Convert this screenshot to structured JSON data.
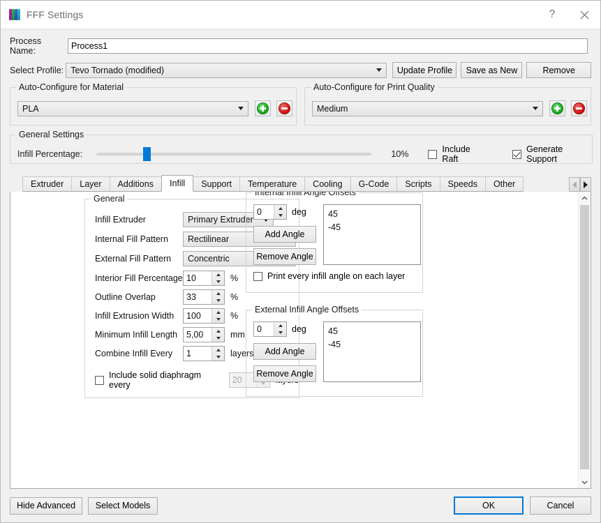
{
  "window": {
    "title": "FFF Settings",
    "icon": "cube-logo-icon",
    "help_label": "?",
    "close_label": "✕"
  },
  "header": {
    "process_name_label": "Process Name:",
    "process_name_value": "Process1",
    "select_profile_label": "Select Profile:",
    "select_profile_value": "Tevo Tornado (modified)",
    "update_profile_label": "Update Profile",
    "save_as_new_label": "Save as New",
    "remove_label": "Remove"
  },
  "material": {
    "group_title": "Auto-Configure for Material",
    "value": "PLA",
    "add_label": "+",
    "remove_label": "−"
  },
  "quality": {
    "group_title": "Auto-Configure for Print Quality",
    "value": "Medium",
    "add_label": "+",
    "remove_label": "−"
  },
  "general_settings": {
    "group_title": "General Settings",
    "infill_label": "Infill Percentage:",
    "infill_value": "10%",
    "infill_percent": 10,
    "include_raft_label": "Include Raft",
    "include_raft_checked": false,
    "generate_support_label": "Generate Support",
    "generate_support_checked": true
  },
  "tabs": {
    "items": [
      {
        "label": "Extruder",
        "active": false
      },
      {
        "label": "Layer",
        "active": false
      },
      {
        "label": "Additions",
        "active": false
      },
      {
        "label": "Infill",
        "active": true
      },
      {
        "label": "Support",
        "active": false
      },
      {
        "label": "Temperature",
        "active": false
      },
      {
        "label": "Cooling",
        "active": false
      },
      {
        "label": "G-Code",
        "active": false
      },
      {
        "label": "Scripts",
        "active": false
      },
      {
        "label": "Speeds",
        "active": false
      },
      {
        "label": "Other",
        "active": false
      }
    ],
    "prev_arrow": "◀",
    "next_arrow": "▶"
  },
  "infill": {
    "general": {
      "group_title": "General",
      "infill_extruder_label": "Infill Extruder",
      "infill_extruder_value": "Primary Extruder",
      "internal_fill_pattern_label": "Internal Fill Pattern",
      "internal_fill_pattern_value": "Rectilinear",
      "external_fill_pattern_label": "External Fill Pattern",
      "external_fill_pattern_value": "Concentric",
      "interior_fill_percentage_label": "Interior Fill Percentage",
      "interior_fill_percentage_value": "10",
      "interior_fill_percentage_unit": "%",
      "outline_overlap_label": "Outline Overlap",
      "outline_overlap_value": "33",
      "outline_overlap_unit": "%",
      "infill_extrusion_width_label": "Infill Extrusion Width",
      "infill_extrusion_width_value": "100",
      "infill_extrusion_width_unit": "%",
      "minimum_infill_length_label": "Minimum Infill Length",
      "minimum_infill_length_value": "5,00",
      "minimum_infill_length_unit": "mm",
      "combine_infill_every_label": "Combine Infill Every",
      "combine_infill_every_value": "1",
      "combine_infill_every_unit": "layers",
      "diaphragm_label": "Include solid diaphragm every",
      "diaphragm_checked": false,
      "diaphragm_value": "20",
      "diaphragm_unit": "layers"
    },
    "internal_offsets": {
      "group_title": "Internal Infill Angle Offsets",
      "angle_value": "0",
      "deg_label": "deg",
      "add_label": "Add Angle",
      "remove_label": "Remove Angle",
      "angles": [
        "45",
        "-45"
      ],
      "print_every_label": "Print every infill angle on each layer",
      "print_every_checked": false
    },
    "external_offsets": {
      "group_title": "External Infill Angle Offsets",
      "angle_value": "0",
      "deg_label": "deg",
      "add_label": "Add Angle",
      "remove_label": "Remove Angle",
      "angles": [
        "45",
        "-45"
      ]
    }
  },
  "footer": {
    "hide_advanced_label": "Hide Advanced",
    "select_models_label": "Select Models",
    "ok_label": "OK",
    "cancel_label": "Cancel"
  },
  "colors": {
    "accent": "#0078d7",
    "add_green": "#16a51e",
    "remove_red": "#cc1111",
    "window_bg": "#f0f0f0"
  }
}
